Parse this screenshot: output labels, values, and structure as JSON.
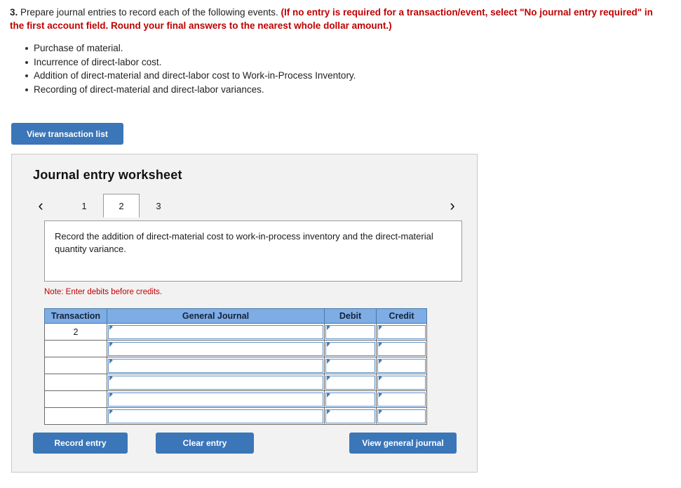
{
  "question": {
    "number": "3.",
    "prompt": "Prepare journal entries to record each of the following events.",
    "instruction": "(If no entry is required for a transaction/event, select \"No journal entry required\" in the first account field. Round your final answers to the nearest whole dollar amount.)",
    "events": [
      "Purchase of material.",
      "Incurrence of direct-labor cost.",
      "Addition of direct-material and direct-labor cost to Work-in-Process Inventory.",
      "Recording of direct-material and direct-labor variances."
    ]
  },
  "toolbar": {
    "view_transaction_list_label": "View transaction list"
  },
  "worksheet": {
    "title": "Journal entry worksheet",
    "nav": {
      "prev_icon": "chevron-left-icon",
      "next_icon": "chevron-right-icon",
      "prev_glyph": "‹",
      "next_glyph": "›"
    },
    "tabs": [
      {
        "label": "1",
        "active": false
      },
      {
        "label": "2",
        "active": true
      },
      {
        "label": "3",
        "active": false
      }
    ],
    "description": "Record the addition of direct-material cost to work-in-process inventory and the direct-material quantity variance.",
    "note": "Note: Enter debits before credits.",
    "table": {
      "headers": [
        "Transaction",
        "General Journal",
        "Debit",
        "Credit"
      ],
      "rows": [
        {
          "transaction": "2",
          "general_journal": "",
          "debit": "",
          "credit": ""
        },
        {
          "transaction": "",
          "general_journal": "",
          "debit": "",
          "credit": ""
        },
        {
          "transaction": "",
          "general_journal": "",
          "debit": "",
          "credit": ""
        },
        {
          "transaction": "",
          "general_journal": "",
          "debit": "",
          "credit": ""
        },
        {
          "transaction": "",
          "general_journal": "",
          "debit": "",
          "credit": ""
        },
        {
          "transaction": "",
          "general_journal": "",
          "debit": "",
          "credit": ""
        }
      ]
    },
    "actions": {
      "record_entry_label": "Record entry",
      "clear_entry_label": "Clear entry",
      "view_general_journal_label": "View general journal"
    }
  },
  "colors": {
    "button_blue": "#3b76b8",
    "table_header_blue": "#7eace4",
    "field_border_blue": "#5b8fc9",
    "alert_red": "#c00000",
    "panel_bg": "#f2f2f2"
  }
}
